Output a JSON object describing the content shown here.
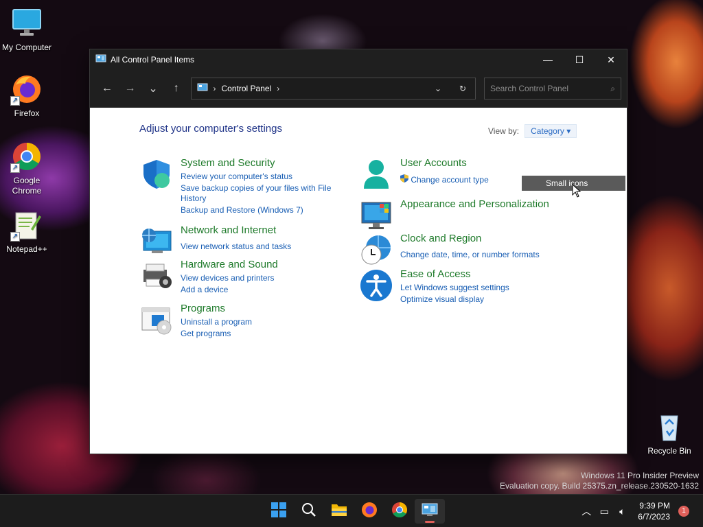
{
  "desktop": {
    "icons": [
      {
        "label": "My Computer",
        "icon": "monitor-icon"
      },
      {
        "label": "Firefox",
        "icon": "firefox-icon"
      },
      {
        "label": "Google Chrome",
        "icon": "chrome-icon"
      },
      {
        "label": "Notepad++",
        "icon": "notepadpp-icon"
      },
      {
        "label": "Recycle Bin",
        "icon": "recycle-bin-icon"
      }
    ],
    "watermark": {
      "line1": "Windows 11 Pro Insider Preview",
      "line2": "Evaluation copy. Build 25375.zn_release.230520-1632"
    }
  },
  "window": {
    "title": "All Control Panel Items",
    "address": {
      "crumb": "Control Panel"
    },
    "search": {
      "placeholder": "Search Control Panel"
    },
    "heading": "Adjust your computer's settings",
    "view_by": {
      "label": "View by:",
      "value": "Category"
    },
    "tooltip": "Small icons",
    "categories": [
      {
        "title": "System and Security",
        "links": [
          "Review your computer's status",
          "Save backup copies of your files with File History",
          "Backup and Restore (Windows 7)"
        ]
      },
      {
        "title": "Network and Internet",
        "links": [
          "View network status and tasks"
        ]
      },
      {
        "title": "Hardware and Sound",
        "links": [
          "View devices and printers",
          "Add a device"
        ]
      },
      {
        "title": "Programs",
        "links": [
          "Uninstall a program",
          "Get programs"
        ]
      },
      {
        "title": "User Accounts",
        "links": [
          "Change account type"
        ]
      },
      {
        "title": "Appearance and Personalization",
        "links": []
      },
      {
        "title": "Clock and Region",
        "links": [
          "Change date, time, or number formats"
        ]
      },
      {
        "title": "Ease of Access",
        "links": [
          "Let Windows suggest settings",
          "Optimize visual display"
        ]
      }
    ]
  },
  "taskbar": {
    "apps": [
      "start-icon",
      "search-icon",
      "file-explorer-icon",
      "firefox-icon",
      "chrome-icon",
      "control-panel-icon"
    ],
    "clock": {
      "time": "9:39 PM",
      "date": "6/7/2023"
    },
    "notification_count": "1"
  },
  "colors": {
    "link": "#1a5fb4",
    "category_title": "#1e7a2a",
    "heading": "#1e3287",
    "titlebar": "#1f1f1f"
  }
}
